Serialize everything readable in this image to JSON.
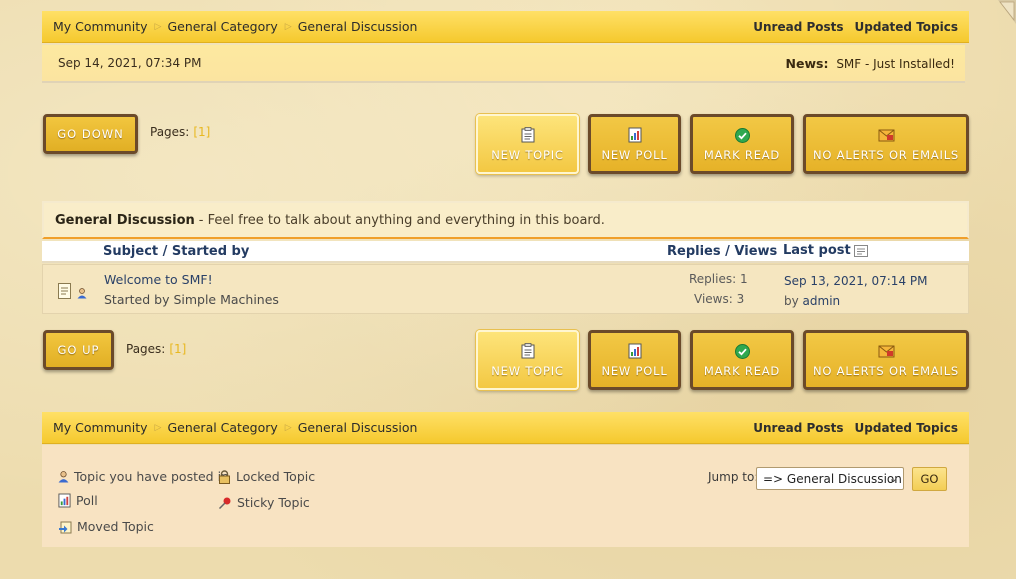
{
  "breadcrumb": {
    "items": [
      "My Community",
      "General Category",
      "General Discussion"
    ],
    "separator": "▷"
  },
  "nav_links": {
    "unread": "Unread Posts",
    "updated": "Updated Topics"
  },
  "news": {
    "date": "Sep 14, 2021, 07:34 PM",
    "label": "News:",
    "text": "SMF - Just Installed!"
  },
  "top_controls": {
    "go_label": "GO DOWN",
    "pages_label": "Pages:",
    "page_current": "[1]"
  },
  "bottom_controls": {
    "go_label": "GO UP",
    "pages_label": "Pages:",
    "page_current": "[1]"
  },
  "actions": {
    "new_topic": "NEW TOPIC",
    "new_poll": "NEW POLL",
    "mark_read": "MARK READ",
    "no_alerts": "NO ALERTS OR EMAILS"
  },
  "board": {
    "name": "General Discussion",
    "description": "- Feel free to talk about anything and everything in this board."
  },
  "columns": {
    "subject": "Subject / Started by",
    "replies_views": "Replies / Views",
    "last_post": "Last post"
  },
  "topics": [
    {
      "title": "Welcome to SMF!",
      "started_by": "Started by Simple Machines",
      "replies": "Replies: 1",
      "views": "Views: 3",
      "last_date": "Sep 13, 2021, 07:14 PM",
      "last_by_prefix": "by",
      "last_by": "admin"
    }
  ],
  "legend": {
    "posted_in": "Topic you have posted in",
    "poll": "Poll",
    "moved": "Moved Topic",
    "locked": "Locked Topic",
    "sticky": "Sticky Topic"
  },
  "jump": {
    "label": "Jump to:",
    "selected": "=> General Discussion",
    "go": "GO"
  },
  "colors": {
    "navbar": "#f5c92e",
    "button_border": "#6b4a2a",
    "link": "#2a4168",
    "accent_orange": "#f09f2a"
  }
}
